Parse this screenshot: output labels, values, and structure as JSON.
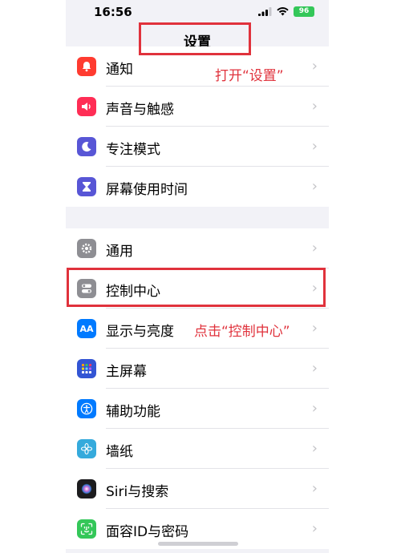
{
  "status_bar": {
    "time": "16:56",
    "battery": "96"
  },
  "nav": {
    "title": "设置"
  },
  "group1": {
    "items": [
      {
        "label": "通知",
        "icon": "bell-icon",
        "color": "#ff3b30"
      },
      {
        "label": "声音与触感",
        "icon": "speaker-icon",
        "color": "#ff2d55"
      },
      {
        "label": "专注模式",
        "icon": "moon-icon",
        "color": "#5856d6"
      },
      {
        "label": "屏幕使用时间",
        "icon": "hourglass-icon",
        "color": "#5856d6"
      }
    ]
  },
  "group2": {
    "items": [
      {
        "label": "通用",
        "icon": "gear-icon",
        "color": "#8e8e93"
      },
      {
        "label": "控制中心",
        "icon": "toggles-icon",
        "color": "#8e8e93"
      },
      {
        "label": "显示与亮度",
        "icon": "text-size-icon",
        "color": "#007aff"
      },
      {
        "label": "主屏幕",
        "icon": "home-grid-icon",
        "color": "#3355d4"
      },
      {
        "label": "辅助功能",
        "icon": "accessibility-icon",
        "color": "#007aff"
      },
      {
        "label": "墙纸",
        "icon": "flower-icon",
        "color": "#35aadc"
      },
      {
        "label": "Siri与搜索",
        "icon": "siri-icon",
        "color": "#1c1c1e"
      },
      {
        "label": "面容ID与密码",
        "icon": "face-id-icon",
        "color": "#34c759"
      }
    ]
  },
  "annotations": {
    "open_settings": "打开“设置”",
    "tap_control_center": "点击“控制中心”"
  },
  "colors": {
    "highlight": "#e0323c",
    "background": "#f2f2f7"
  },
  "chevron": "›"
}
